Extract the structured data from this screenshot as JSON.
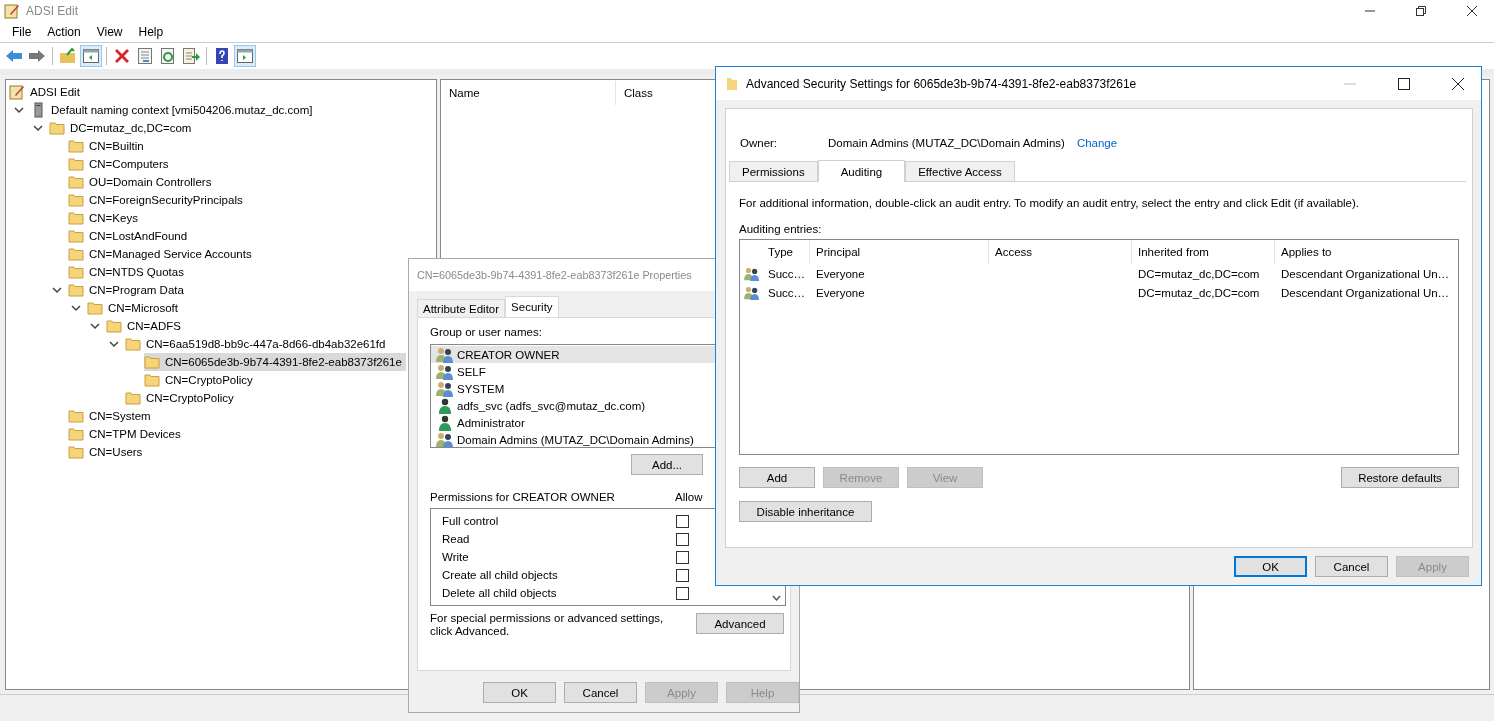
{
  "window": {
    "title": "ADSI Edit"
  },
  "menu": [
    "File",
    "Action",
    "View",
    "Help"
  ],
  "toolbar": [
    {
      "kind": "back",
      "pressed": false
    },
    {
      "kind": "forward",
      "pressed": false
    },
    {
      "kind": "separator"
    },
    {
      "kind": "up-folder",
      "pressed": false
    },
    {
      "kind": "show-tree",
      "pressed": true
    },
    {
      "kind": "separator"
    },
    {
      "kind": "delete",
      "pressed": false
    },
    {
      "kind": "properties",
      "pressed": false
    },
    {
      "kind": "refresh",
      "pressed": false
    },
    {
      "kind": "export",
      "pressed": false
    },
    {
      "kind": "separator"
    },
    {
      "kind": "help",
      "pressed": false
    },
    {
      "kind": "show-action",
      "pressed": true
    }
  ],
  "tree": {
    "root": "ADSI Edit",
    "items": [
      {
        "label": "Default naming context [vmi504206.mutaz_dc.com]",
        "kind": "server",
        "expanded": true,
        "selected": false,
        "children": [
          {
            "label": "DC=mutaz_dc,DC=com",
            "kind": "folder",
            "expanded": true,
            "selected": false,
            "children": [
              {
                "label": "CN=Builtin",
                "kind": "folder",
                "selected": false
              },
              {
                "label": "CN=Computers",
                "kind": "folder",
                "selected": false
              },
              {
                "label": "OU=Domain Controllers",
                "kind": "folder",
                "selected": false
              },
              {
                "label": "CN=ForeignSecurityPrincipals",
                "kind": "folder",
                "selected": false
              },
              {
                "label": "CN=Keys",
                "kind": "folder",
                "selected": false
              },
              {
                "label": "CN=LostAndFound",
                "kind": "folder",
                "selected": false
              },
              {
                "label": "CN=Managed Service Accounts",
                "kind": "folder",
                "selected": false
              },
              {
                "label": "CN=NTDS Quotas",
                "kind": "folder",
                "selected": false
              },
              {
                "label": "CN=Program Data",
                "kind": "folder",
                "expanded": true,
                "selected": false,
                "children": [
                  {
                    "label": "CN=Microsoft",
                    "kind": "folder",
                    "expanded": true,
                    "selected": false,
                    "children": [
                      {
                        "label": "CN=ADFS",
                        "kind": "folder",
                        "expanded": true,
                        "selected": false,
                        "children": [
                          {
                            "label": "CN=6aa519d8-bb9c-447a-8d66-db4ab32e61fd",
                            "kind": "folder",
                            "expanded": true,
                            "selected": false,
                            "children": [
                              {
                                "label": "CN=6065de3b-9b74-4391-8fe2-eab8373f261e",
                                "kind": "folder",
                                "selected": true
                              },
                              {
                                "label": "CN=CryptoPolicy",
                                "kind": "folder",
                                "selected": false
                              }
                            ]
                          },
                          {
                            "label": "CN=CryptoPolicy",
                            "kind": "folder",
                            "selected": false
                          }
                        ]
                      }
                    ]
                  }
                ]
              },
              {
                "label": "CN=System",
                "kind": "folder",
                "selected": false
              },
              {
                "label": "CN=TPM Devices",
                "kind": "folder",
                "selected": false
              },
              {
                "label": "CN=Users",
                "kind": "folder",
                "selected": false
              }
            ]
          }
        ]
      }
    ]
  },
  "list": {
    "columns": [
      "Name",
      "Class"
    ]
  },
  "properties": {
    "title": "CN=6065de3b-9b74-4391-8fe2-eab8373f261e Properties",
    "tabs": [
      {
        "label": "Attribute Editor",
        "selected": false
      },
      {
        "label": "Security",
        "selected": true
      }
    ],
    "group_label": "Group or user names:",
    "groups": [
      {
        "name": "CREATOR OWNER",
        "kind": "group",
        "selected": true
      },
      {
        "name": "SELF",
        "kind": "group",
        "selected": false
      },
      {
        "name": "SYSTEM",
        "kind": "group",
        "selected": false
      },
      {
        "name": "adfs_svc (adfs_svc@mutaz_dc.com)",
        "kind": "user",
        "selected": false
      },
      {
        "name": "Administrator",
        "kind": "user",
        "selected": false
      },
      {
        "name": "Domain Admins (MUTAZ_DC\\Domain Admins)",
        "kind": "group",
        "selected": false
      }
    ],
    "add_button": "Add...",
    "permissions_label": "Permissions for CREATOR OWNER",
    "allow_header": "Allow",
    "permissions": [
      {
        "name": "Full control",
        "allow": false
      },
      {
        "name": "Read",
        "allow": false
      },
      {
        "name": "Write",
        "allow": false
      },
      {
        "name": "Create all child objects",
        "allow": false
      },
      {
        "name": "Delete all child objects",
        "allow": false
      }
    ],
    "advanced_note": "For special permissions or advanced settings, click Advanced.",
    "advanced_button": "Advanced",
    "buttons": [
      {
        "label": "OK",
        "disabled": false
      },
      {
        "label": "Cancel",
        "disabled": false
      },
      {
        "label": "Apply",
        "disabled": true
      },
      {
        "label": "Help",
        "disabled": true
      }
    ]
  },
  "advanced": {
    "title": "Advanced Security Settings for 6065de3b-9b74-4391-8fe2-eab8373f261e",
    "owner_label": "Owner:",
    "owner": "Domain Admins (MUTAZ_DC\\Domain Admins)",
    "change_link": "Change",
    "tabs": [
      {
        "label": "Permissions",
        "selected": false
      },
      {
        "label": "Auditing",
        "selected": true
      },
      {
        "label": "Effective Access",
        "selected": false
      }
    ],
    "info": "For additional information, double-click an audit entry. To modify an audit entry, select the entry and click Edit (if available).",
    "entries_label": "Auditing entries:",
    "columns": [
      "Type",
      "Principal",
      "Access",
      "Inherited from",
      "Applies to"
    ],
    "rows": [
      {
        "type": "Succ…",
        "principal": "Everyone",
        "inherited_from": "DC=mutaz_dc,DC=com",
        "applies_to": "Descendant Organizational Un…"
      },
      {
        "type": "Succ…",
        "principal": "Everyone",
        "inherited_from": "DC=mutaz_dc,DC=com",
        "applies_to": "Descendant Organizational Un…"
      }
    ],
    "actions": [
      {
        "label": "Add",
        "disabled": false
      },
      {
        "label": "Remove",
        "disabled": true
      },
      {
        "label": "View",
        "disabled": true
      }
    ],
    "restore_button": "Restore defaults",
    "inheritance_button": "Disable inheritance",
    "buttons": [
      {
        "label": "OK",
        "disabled": false,
        "default": true
      },
      {
        "label": "Cancel",
        "disabled": false,
        "default": false
      },
      {
        "label": "Apply",
        "disabled": true,
        "default": false
      }
    ]
  }
}
